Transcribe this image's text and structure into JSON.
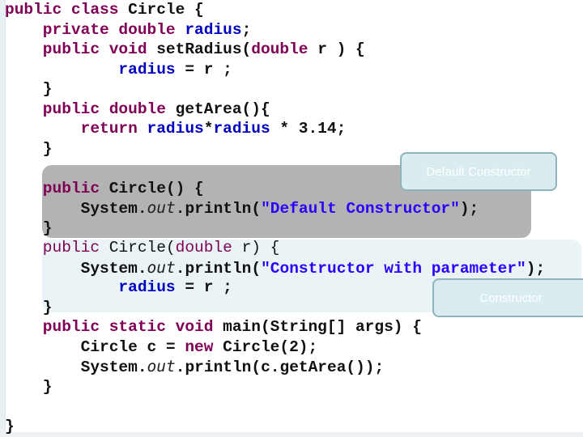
{
  "code": {
    "lines": [
      {
        "tokens": [
          {
            "t": "public class ",
            "c": "kw"
          },
          {
            "t": "Circle {",
            "c": ""
          }
        ]
      },
      {
        "tokens": [
          {
            "t": "    private double ",
            "c": "kw"
          },
          {
            "t": "radius",
            "c": "fld"
          },
          {
            "t": ";",
            "c": ""
          }
        ]
      },
      {
        "tokens": [
          {
            "t": "    public void ",
            "c": "kw"
          },
          {
            "t": "setRadius(",
            "c": ""
          },
          {
            "t": "double ",
            "c": "kw"
          },
          {
            "t": "r ) {",
            "c": ""
          }
        ]
      },
      {
        "tokens": [
          {
            "t": "            radius",
            "c": "fld"
          },
          {
            "t": " = r ;",
            "c": ""
          }
        ]
      },
      {
        "tokens": [
          {
            "t": "    }",
            "c": ""
          }
        ]
      },
      {
        "tokens": [
          {
            "t": "    public double ",
            "c": "kw"
          },
          {
            "t": "getArea(){",
            "c": ""
          }
        ]
      },
      {
        "tokens": [
          {
            "t": "        return ",
            "c": "kw"
          },
          {
            "t": "radius",
            "c": "fld"
          },
          {
            "t": "*",
            "c": ""
          },
          {
            "t": "radius",
            "c": "fld"
          },
          {
            "t": " * 3.14;",
            "c": ""
          }
        ]
      },
      {
        "tokens": [
          {
            "t": "    }",
            "c": ""
          }
        ]
      },
      {
        "tokens": [
          {
            "t": "",
            "c": ""
          }
        ]
      },
      {
        "tokens": [
          {
            "t": "    public ",
            "c": "kw"
          },
          {
            "t": "Circle() {",
            "c": ""
          }
        ]
      },
      {
        "tokens": [
          {
            "t": "        System.",
            "c": ""
          },
          {
            "t": "out",
            "c": "st"
          },
          {
            "t": ".println(",
            "c": ""
          },
          {
            "t": "\"Default Constructor\"",
            "c": "str"
          },
          {
            "t": ");",
            "c": ""
          }
        ]
      },
      {
        "tokens": [
          {
            "t": "    }",
            "c": ""
          }
        ]
      },
      {
        "tokens": [
          {
            "t": "    public ",
            "c": "kw normal"
          },
          {
            "t": "Circle(",
            "c": "normal"
          },
          {
            "t": "double ",
            "c": "kw normal"
          },
          {
            "t": "r) {",
            "c": "normal"
          }
        ]
      },
      {
        "tokens": [
          {
            "t": "        System.",
            "c": ""
          },
          {
            "t": "out",
            "c": "st"
          },
          {
            "t": ".println(",
            "c": ""
          },
          {
            "t": "\"Constructor with parameter\"",
            "c": "str"
          },
          {
            "t": ");",
            "c": ""
          }
        ]
      },
      {
        "tokens": [
          {
            "t": "            radius",
            "c": "fld"
          },
          {
            "t": " = r ;",
            "c": ""
          }
        ]
      },
      {
        "tokens": [
          {
            "t": "    }",
            "c": ""
          }
        ]
      },
      {
        "tokens": [
          {
            "t": "    public static void ",
            "c": "kw"
          },
          {
            "t": "main(String[] args) {",
            "c": ""
          }
        ]
      },
      {
        "tokens": [
          {
            "t": "        Circle c = ",
            "c": ""
          },
          {
            "t": "new ",
            "c": "kw"
          },
          {
            "t": "Circle(2);",
            "c": ""
          }
        ]
      },
      {
        "tokens": [
          {
            "t": "        System.",
            "c": ""
          },
          {
            "t": "out",
            "c": "st"
          },
          {
            "t": ".println(c.getArea());",
            "c": ""
          }
        ]
      },
      {
        "tokens": [
          {
            "t": "    }",
            "c": ""
          }
        ]
      },
      {
        "tokens": [
          {
            "t": "",
            "c": ""
          }
        ]
      },
      {
        "tokens": [
          {
            "t": "}",
            "c": ""
          }
        ]
      }
    ]
  },
  "callouts": {
    "default_constructor": "Default Constructor",
    "constructor": "Constructor"
  }
}
